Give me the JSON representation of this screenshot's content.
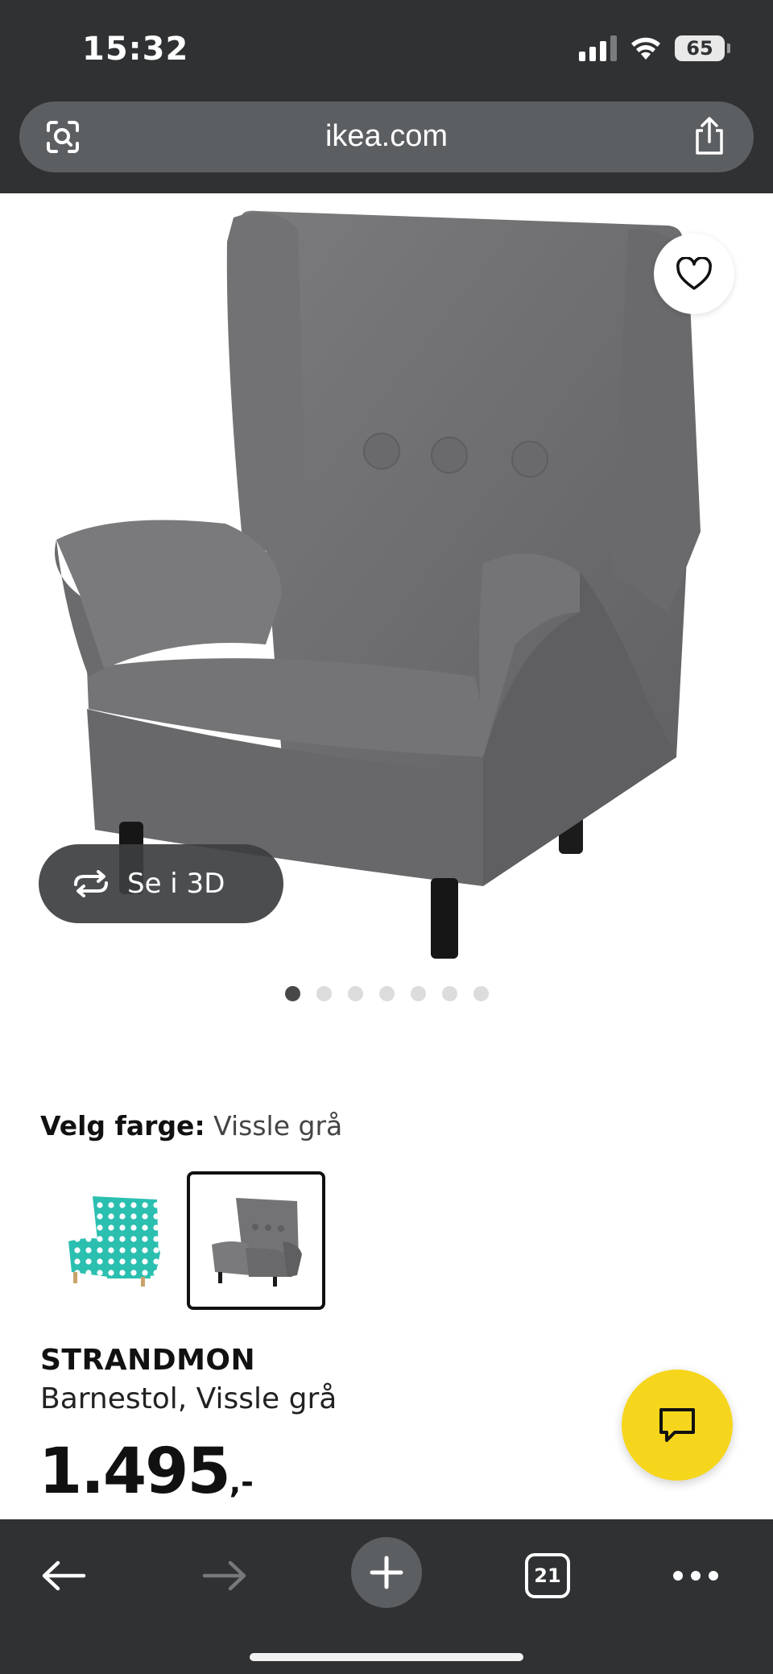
{
  "status_bar": {
    "time": "15:32",
    "battery": "65",
    "icons": [
      "cellular-signal-icon",
      "wifi-icon",
      "battery-icon"
    ]
  },
  "browser": {
    "url": "ikea.com",
    "left_icon": "visual-search-icon",
    "right_icon": "share-icon"
  },
  "product_image": {
    "favorite_icon": "heart-icon",
    "view_3d_label": "Se i 3D",
    "view_3d_icon": "rotate-icon",
    "carousel_count": 7,
    "carousel_active_index": 0
  },
  "color_selector": {
    "label": "Velg farge:",
    "value": "Vissle grå",
    "options": [
      {
        "name": "turquoise-dot-variant",
        "selected": false,
        "color": "#2bbfb0"
      },
      {
        "name": "vissle-gray-variant",
        "selected": true,
        "color": "#6e6e70"
      }
    ]
  },
  "product": {
    "name": "STRANDMON",
    "description": "Barnestol, Vissle grå",
    "price": "1.495",
    "price_suffix": ",-"
  },
  "chat": {
    "icon": "chat-icon",
    "color": "#f6d61d"
  },
  "toolbar": {
    "back_icon": "back-arrow-icon",
    "forward_icon": "forward-arrow-icon",
    "new_tab_icon": "plus-icon",
    "tab_count": "21",
    "more_icon": "more-dots-icon"
  },
  "colors": {
    "chrome_bg": "#2f3133",
    "chair_gray": "#6e6e70",
    "ikea_yellow": "#f6d61d"
  }
}
